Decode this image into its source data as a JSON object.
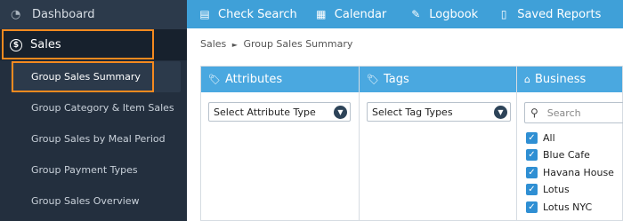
{
  "sidebar": {
    "dashboard": {
      "label": "Dashboard",
      "icon": "dashboard-icon"
    },
    "sales": {
      "label": "Sales",
      "icon": "dollar-icon"
    },
    "items": [
      {
        "label": "Group Sales Summary",
        "active": true
      },
      {
        "label": "Group Category & Item Sales"
      },
      {
        "label": "Group Sales by Meal Period"
      },
      {
        "label": "Group Payment Types"
      },
      {
        "label": "Group Sales Overview"
      }
    ]
  },
  "topnav": [
    {
      "label": "Check Search",
      "icon": "document-icon"
    },
    {
      "label": "Calendar",
      "icon": "calendar-icon"
    },
    {
      "label": "Logbook",
      "icon": "edit-icon"
    },
    {
      "label": "Saved Reports",
      "icon": "file-icon"
    }
  ],
  "breadcrumb": {
    "section": "Sales",
    "separator": "►",
    "page": "Group Sales Summary"
  },
  "panels": {
    "attributes": {
      "title": "Attributes",
      "icon": "tag-icon",
      "select": "Select Attribute Type"
    },
    "tags": {
      "title": "Tags",
      "icon": "tag-icon",
      "select": "Select Tag Types"
    },
    "business": {
      "title": "Business",
      "icon": "home-icon",
      "search_placeholder": "Search",
      "options": [
        {
          "label": "All",
          "checked": true
        },
        {
          "label": "Blue Cafe",
          "checked": true
        },
        {
          "label": "Havana House",
          "checked": true
        },
        {
          "label": "Lotus",
          "checked": true
        },
        {
          "label": "Lotus NYC",
          "checked": true
        }
      ]
    }
  },
  "colors": {
    "accent": "#3fa0d8",
    "sidebar": "#232f3e",
    "highlight": "#f58a1f"
  }
}
